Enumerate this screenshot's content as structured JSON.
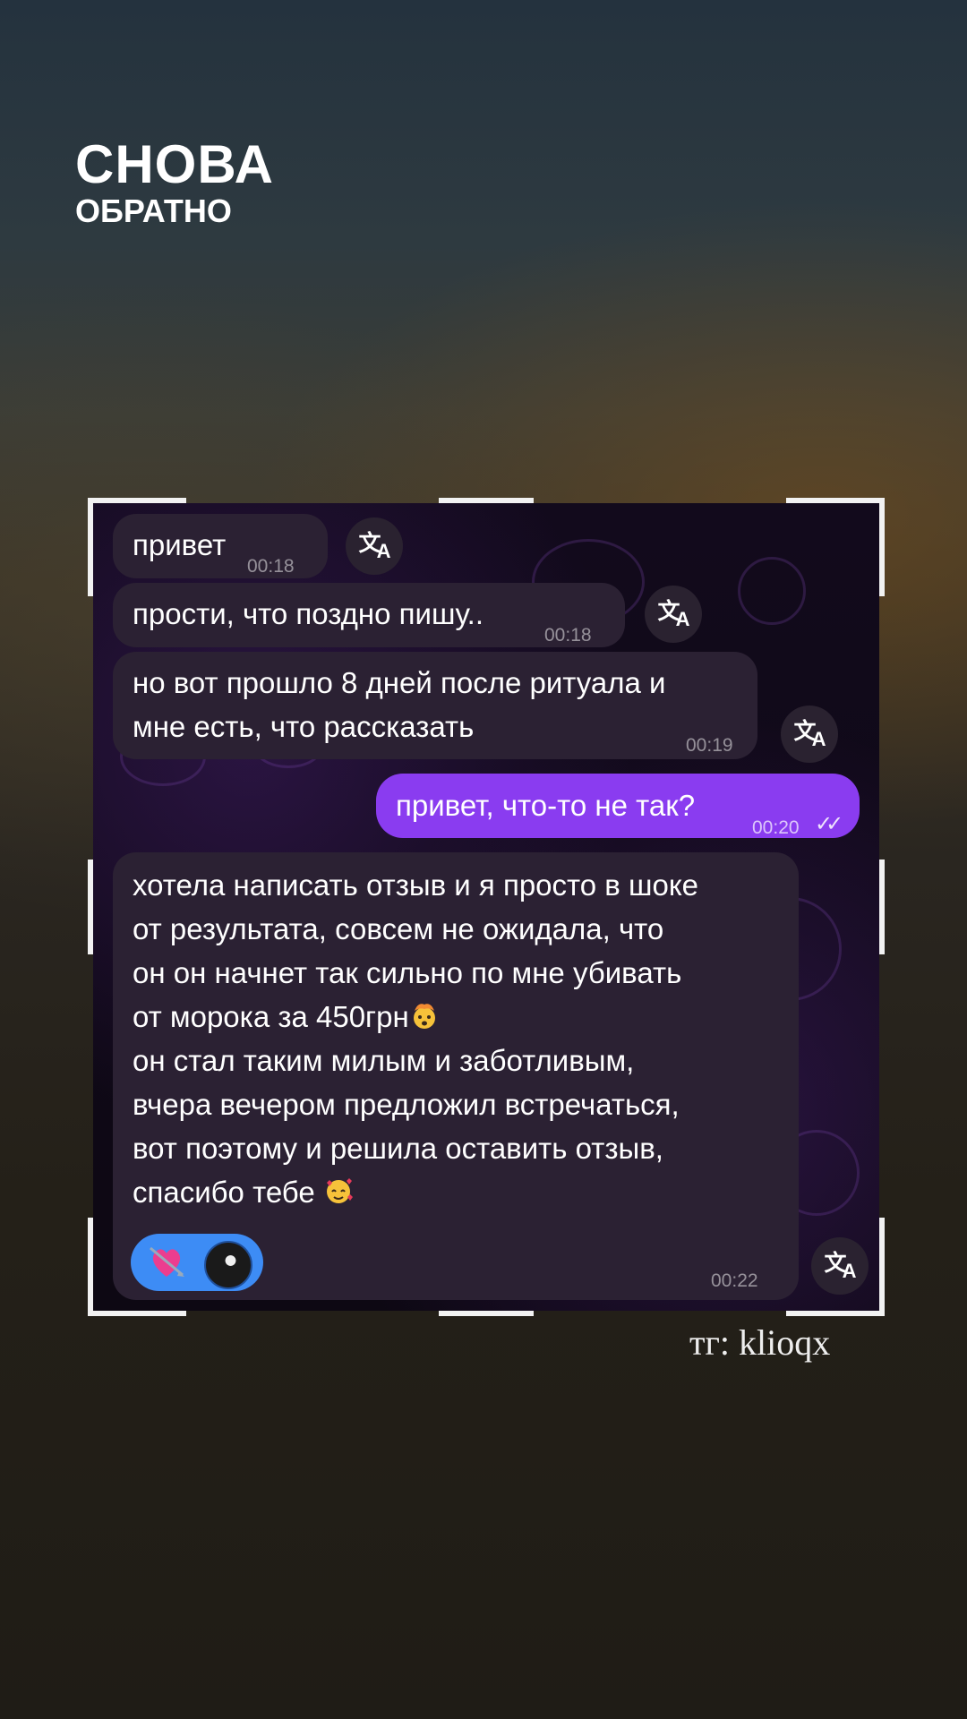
{
  "header": {
    "title": "СНОВА",
    "subtitle": "ОБРАТНО"
  },
  "messages": [
    {
      "direction": "incoming",
      "text": "привет",
      "time": "00:18"
    },
    {
      "direction": "incoming",
      "text": "прости, что поздно пишу..",
      "time": "00:18"
    },
    {
      "direction": "incoming",
      "text": "но вот прошло 8 дней после ритуала и\nмне есть, что рассказать",
      "time": "00:19"
    },
    {
      "direction": "outgoing",
      "text": "привет, что-то не так?",
      "time": "00:20",
      "status": "read"
    },
    {
      "direction": "incoming",
      "text_lines": [
        "хотела написать отзыв и я просто в шоке",
        "от результата, совсем не ожидала, что",
        "он он начнет так сильно по мне убивать",
        "от морока за 450грн",
        "он стал таким милым и заботливым,",
        "вчера вечером предложил встречаться,",
        "вот поэтому и решила оставить отзыв,",
        "спасибо тебе "
      ],
      "time": "00:22",
      "reactions": [
        {
          "icon": "heart-with-arrow-icon"
        },
        {
          "icon": "avatar"
        }
      ]
    }
  ],
  "icons": {
    "translate": "translate-icon",
    "translate_glyph_a": "文",
    "translate_glyph_b": "A"
  },
  "watermark": "тг: klioqx",
  "colors": {
    "outgoing_bubble": "#8a3cf0",
    "incoming_bubble": "#2b2133",
    "reaction_pill": "#3d8cf5"
  }
}
